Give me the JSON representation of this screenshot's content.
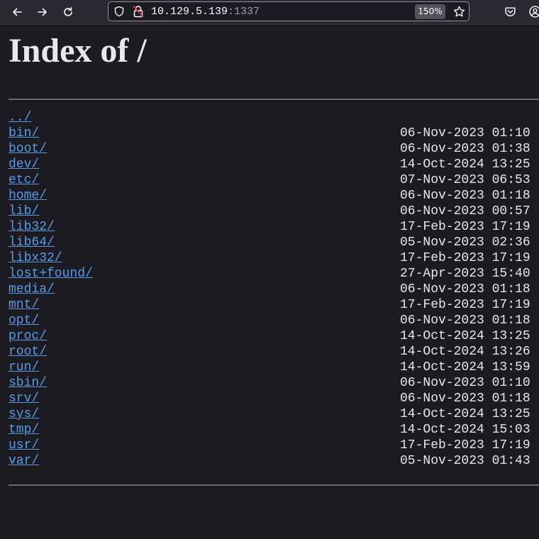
{
  "browser": {
    "url_host": "10.129.5.139",
    "url_port": ":1337",
    "zoom": "150%"
  },
  "page": {
    "title": "Index of /",
    "entries": [
      {
        "name": "../",
        "date": ""
      },
      {
        "name": "bin/",
        "date": "06-Nov-2023 01:10"
      },
      {
        "name": "boot/",
        "date": "06-Nov-2023 01:38"
      },
      {
        "name": "dev/",
        "date": "14-Oct-2024 13:25"
      },
      {
        "name": "etc/",
        "date": "07-Nov-2023 06:53"
      },
      {
        "name": "home/",
        "date": "06-Nov-2023 01:18"
      },
      {
        "name": "lib/",
        "date": "06-Nov-2023 00:57"
      },
      {
        "name": "lib32/",
        "date": "17-Feb-2023 17:19"
      },
      {
        "name": "lib64/",
        "date": "05-Nov-2023 02:36"
      },
      {
        "name": "libx32/",
        "date": "17-Feb-2023 17:19"
      },
      {
        "name": "lost+found/",
        "date": "27-Apr-2023 15:40"
      },
      {
        "name": "media/",
        "date": "06-Nov-2023 01:18"
      },
      {
        "name": "mnt/",
        "date": "17-Feb-2023 17:19"
      },
      {
        "name": "opt/",
        "date": "06-Nov-2023 01:18"
      },
      {
        "name": "proc/",
        "date": "14-Oct-2024 13:25"
      },
      {
        "name": "root/",
        "date": "14-Oct-2024 13:26"
      },
      {
        "name": "run/",
        "date": "14-Oct-2024 13:59"
      },
      {
        "name": "sbin/",
        "date": "06-Nov-2023 01:10"
      },
      {
        "name": "srv/",
        "date": "06-Nov-2023 01:18"
      },
      {
        "name": "sys/",
        "date": "14-Oct-2024 13:25"
      },
      {
        "name": "tmp/",
        "date": "14-Oct-2024 15:03"
      },
      {
        "name": "usr/",
        "date": "17-Feb-2023 17:19"
      },
      {
        "name": "var/",
        "date": "05-Nov-2023 01:43"
      }
    ]
  }
}
